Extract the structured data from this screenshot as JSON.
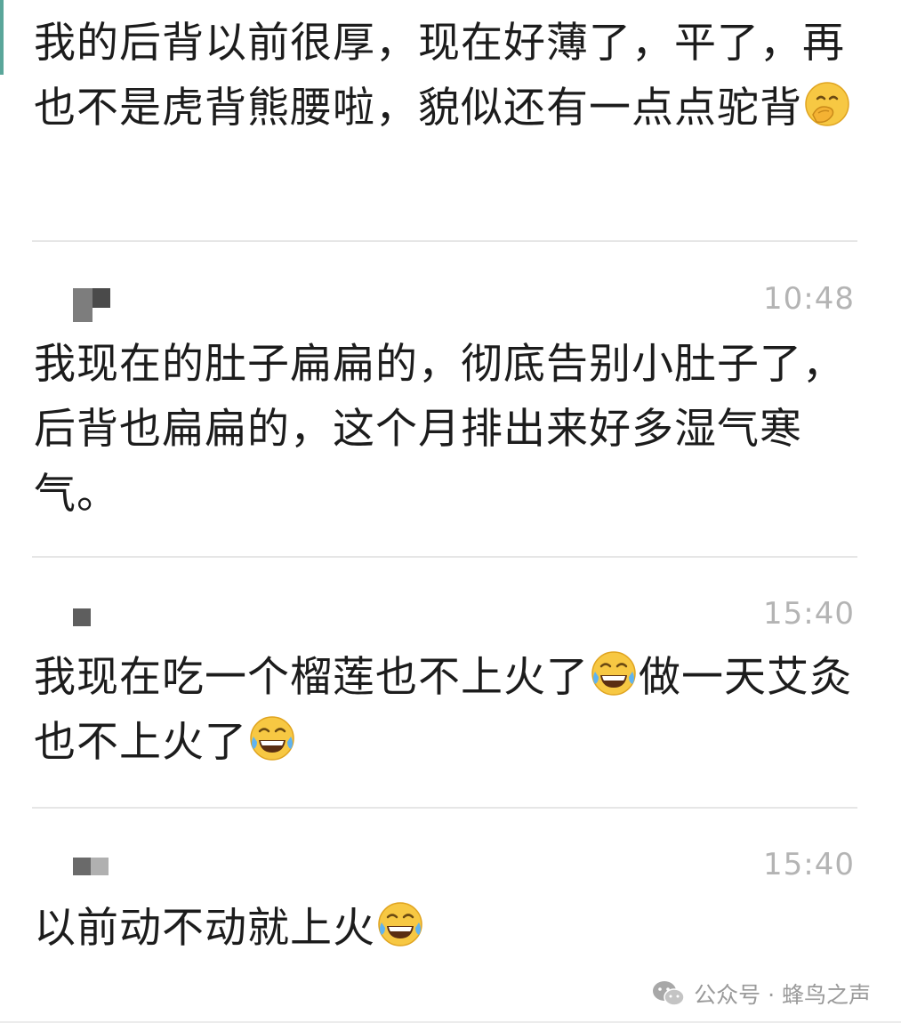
{
  "messages": [
    {
      "text_parts": [
        "我的后背以前很厚，现在好薄了，平了，再也不是虎背熊腰啦，貌似还有一点点驼背"
      ],
      "emoji": "hand-over-mouth-emoji"
    },
    {
      "time": "10:48",
      "text_parts": [
        "我现在的肚子扁扁的，彻底告别小肚子了，后背也扁扁的，这个月排出来好多湿气寒气。"
      ]
    },
    {
      "time": "15:40",
      "text_parts": [
        "我现在吃一个榴莲也不上火了",
        "做一天艾灸也不上火了"
      ],
      "emoji": "tears-of-joy-emoji"
    },
    {
      "time": "15:40",
      "text_parts": [
        "以前动不动就上火"
      ],
      "emoji": "tears-of-joy-emoji"
    }
  ],
  "watermark": {
    "text": "公众号 · 蜂鸟之声",
    "icon": "wechat-icon"
  },
  "colors": {
    "text": "#1c1c1c",
    "timestamp": "#b4b4b4",
    "divider": "#e6e6e6",
    "accent": "#5aa69a"
  }
}
